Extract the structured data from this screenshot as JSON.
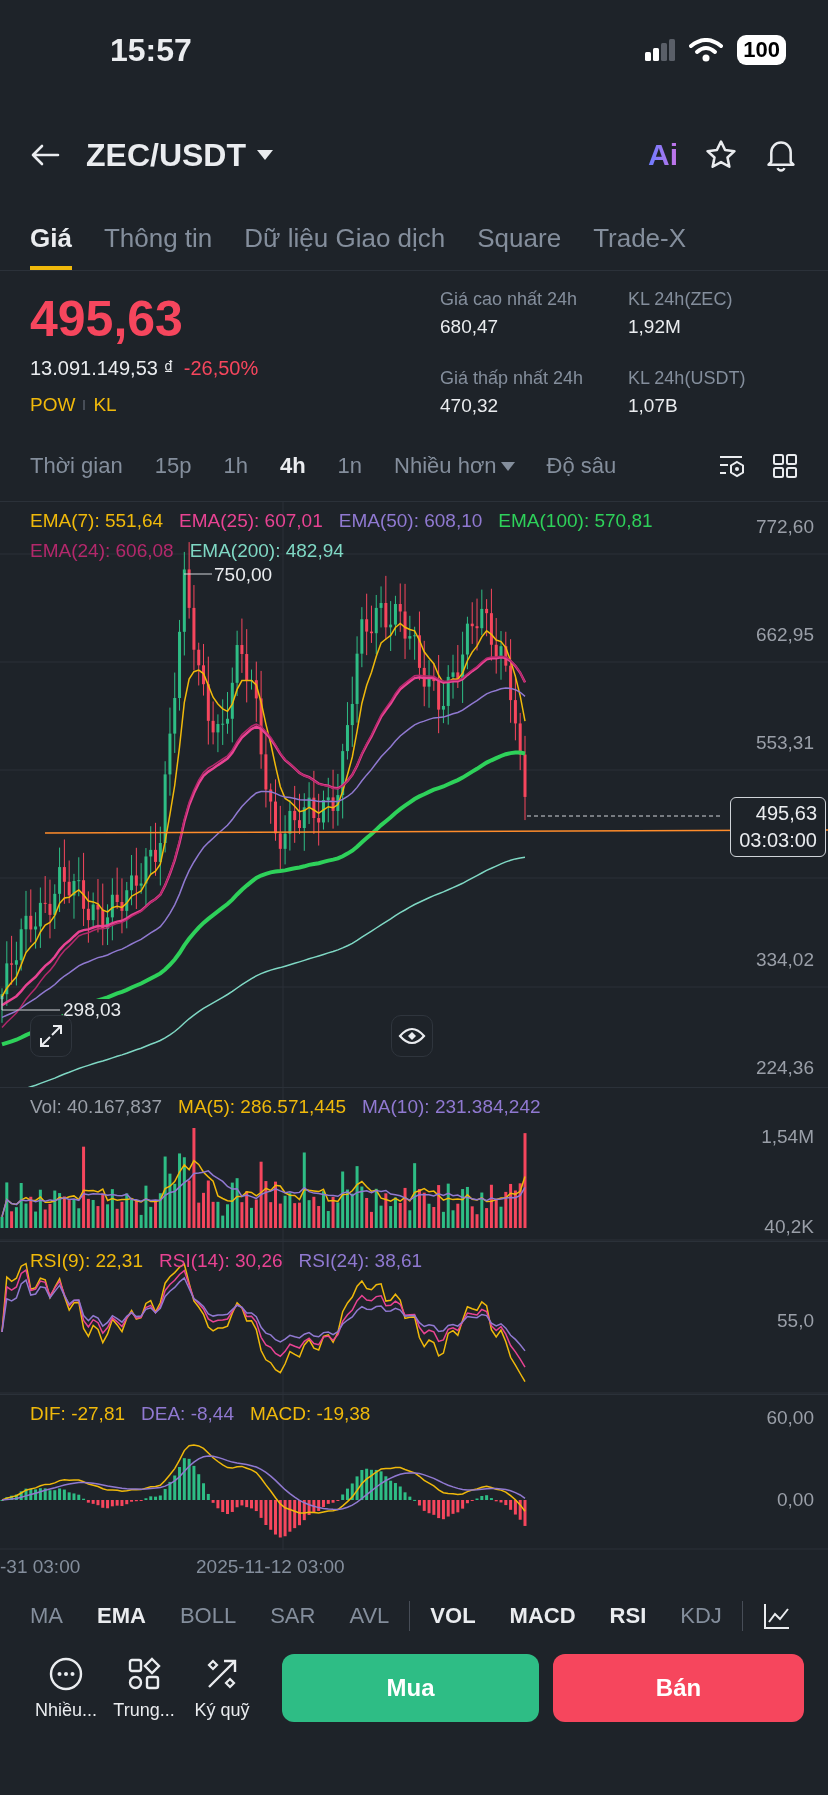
{
  "status_bar": {
    "time": "15:57",
    "battery": "100"
  },
  "header": {
    "title": "ZEC/USDT",
    "ai_label": "Ai"
  },
  "tabs": [
    {
      "label": "Giá",
      "selected": true
    },
    {
      "label": "Thông tin",
      "selected": false
    },
    {
      "label": "Dữ liệu Giao dịch",
      "selected": false
    },
    {
      "label": "Square",
      "selected": false
    },
    {
      "label": "Trade-X",
      "selected": false
    }
  ],
  "price": {
    "last": "495,63",
    "fiat": "13.091.149,53 ₫",
    "change": "-26,50%",
    "tags": [
      "POW",
      "KL"
    ]
  },
  "stats": [
    {
      "label": "Giá cao nhất 24h",
      "value": "680,47"
    },
    {
      "label": "KL 24h(ZEC)",
      "value": "1,92M"
    },
    {
      "label": "Giá thấp nhất 24h",
      "value": "470,32"
    },
    {
      "label": "KL 24h(USDT)",
      "value": "1,07B"
    }
  ],
  "timeframe_bar": {
    "label": "Thời gian",
    "more": "Nhiều hơn",
    "depth": "Độ sâu",
    "items": [
      {
        "label": "15p",
        "selected": false
      },
      {
        "label": "1h",
        "selected": false
      },
      {
        "label": "4h",
        "selected": true
      },
      {
        "label": "1n",
        "selected": false
      }
    ]
  },
  "price_chart": {
    "legend": [
      {
        "label": "EMA(7): 551,64",
        "color": "#f0b90b"
      },
      {
        "label": "EMA(25): 607,01",
        "color": "#e84393"
      },
      {
        "label": "EMA(50): 608,10",
        "color": "#9079d1"
      },
      {
        "label": "EMA(100): 570,81",
        "color": "#2ed15a"
      },
      {
        "label": "EMA(24): 606,08",
        "color": "#b3286b"
      },
      {
        "label": "EMA(200): 482,94",
        "color": "#7fd8c4"
      }
    ],
    "y_labels": [
      "772,60",
      "662,95",
      "553,31",
      "334,02",
      "224,36"
    ],
    "high_marker": "750,00",
    "low_marker": "298,03",
    "current_price": "495,63",
    "countdown": "03:03:00"
  },
  "volume_panel": {
    "legend": [
      {
        "label": "Vol: 40.167,837",
        "color": "#9a9fa8"
      },
      {
        "label": "MA(5): 286.571,445",
        "color": "#f0b90b"
      },
      {
        "label": "MA(10): 231.384,242",
        "color": "#9079d1"
      }
    ],
    "y_labels": [
      "1,54M",
      "40,2K"
    ]
  },
  "rsi_panel": {
    "legend": [
      {
        "label": "RSI(9): 22,31",
        "color": "#f0b90b"
      },
      {
        "label": "RSI(14): 30,26",
        "color": "#e84393"
      },
      {
        "label": "RSI(24): 38,61",
        "color": "#9079d1"
      }
    ],
    "y_labels": [
      "55,0"
    ]
  },
  "macd_panel": {
    "legend": [
      {
        "label": "DIF: -27,81",
        "color": "#f0b90b"
      },
      {
        "label": "DEA: -8,44",
        "color": "#9079d1"
      },
      {
        "label": "MACD: -19,38",
        "color": "#f0b90b"
      }
    ],
    "y_labels": [
      "60,00",
      "0,00"
    ]
  },
  "time_axis": [
    "-31 03:00",
    "2025-11-12 03:00"
  ],
  "main_indicators": [
    {
      "label": "MA",
      "selected": false
    },
    {
      "label": "EMA",
      "selected": true
    },
    {
      "label": "BOLL",
      "selected": false
    },
    {
      "label": "SAR",
      "selected": false
    },
    {
      "label": "AVL",
      "selected": false
    }
  ],
  "sub_indicators": [
    {
      "label": "VOL",
      "selected": true
    },
    {
      "label": "MACD",
      "selected": true
    },
    {
      "label": "RSI",
      "selected": true
    },
    {
      "label": "KDJ",
      "selected": false
    }
  ],
  "actions": [
    {
      "kind": "more",
      "label": "Nhiều..."
    },
    {
      "kind": "grid",
      "label": "Trung..."
    },
    {
      "kind": "margin",
      "label": "Ký quỹ"
    }
  ],
  "buy_button": "Mua",
  "sell_button": "Bán"
}
